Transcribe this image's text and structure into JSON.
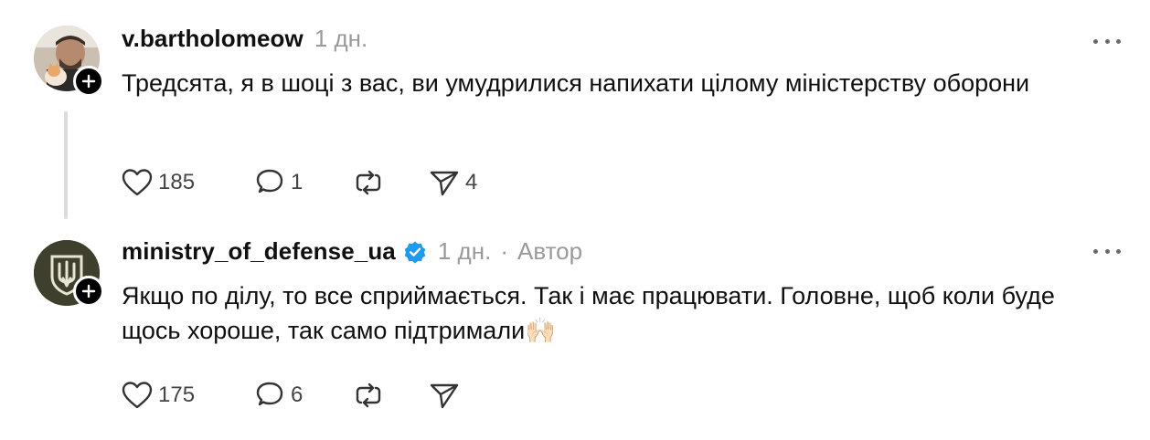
{
  "comments": [
    {
      "username": "v.bartholomeow",
      "time": "1 дн.",
      "text": "Тредсята, я в шоці з вас, ви умудрилися напихати цілому міністерству оборони",
      "likes": "185",
      "replies": "1",
      "shares": "4",
      "avatar_icon": "user-photo-avatar",
      "verified": false
    },
    {
      "username": "ministry_of_defense_ua",
      "time": "1 дн.",
      "separator": "·",
      "author_label": "Автор",
      "text": "Якщо по ділу, то все сприймається. Так і має працювати. Головне, щоб коли буде щось хороше, так само підтримали🙌🏻",
      "likes": "175",
      "replies": "6",
      "avatar_icon": "ministry-emblem-avatar",
      "verified": true
    }
  ],
  "colors": {
    "verified": "#1d9bf0",
    "meta": "#9a9a9a",
    "text": "#101010",
    "thread_line": "#dcdcdc"
  }
}
